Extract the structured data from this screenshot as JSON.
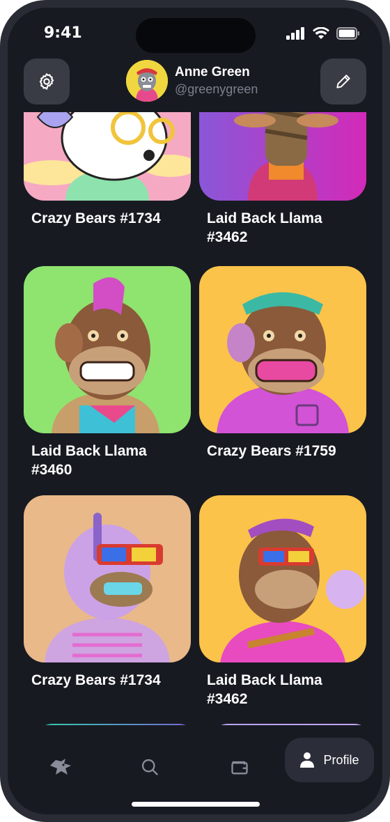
{
  "status_bar": {
    "time": "9:41"
  },
  "header": {
    "settings_icon": "gear-icon",
    "edit_icon": "pencil-icon",
    "user_name": "Anne Green",
    "user_handle": "@greenygreen"
  },
  "nft_cards": [
    {
      "title": "Crazy Bears #1734",
      "bg_color": "#f7b7c9"
    },
    {
      "title": "Laid Back Llama #3462",
      "bg_color": "#c23dc9"
    },
    {
      "title": "Laid Back Llama #3460",
      "bg_color": "#8fe36f"
    },
    {
      "title": "Crazy Bears #1759",
      "bg_color": "#fbc34a"
    },
    {
      "title": "Crazy Bears #1734",
      "bg_color": "#e9b98a"
    },
    {
      "title": "Laid Back Llama #3462",
      "bg_color": "#fbc34a"
    }
  ],
  "bottom_nav": {
    "items": [
      {
        "icon": "fox-icon"
      },
      {
        "icon": "search-icon"
      },
      {
        "icon": "wallet-icon"
      },
      {
        "icon": "user-icon",
        "label": "Profile",
        "active": true
      }
    ]
  },
  "colors": {
    "background": "#181a22",
    "panel": "#3a3c45",
    "muted_text": "#7d808b"
  }
}
